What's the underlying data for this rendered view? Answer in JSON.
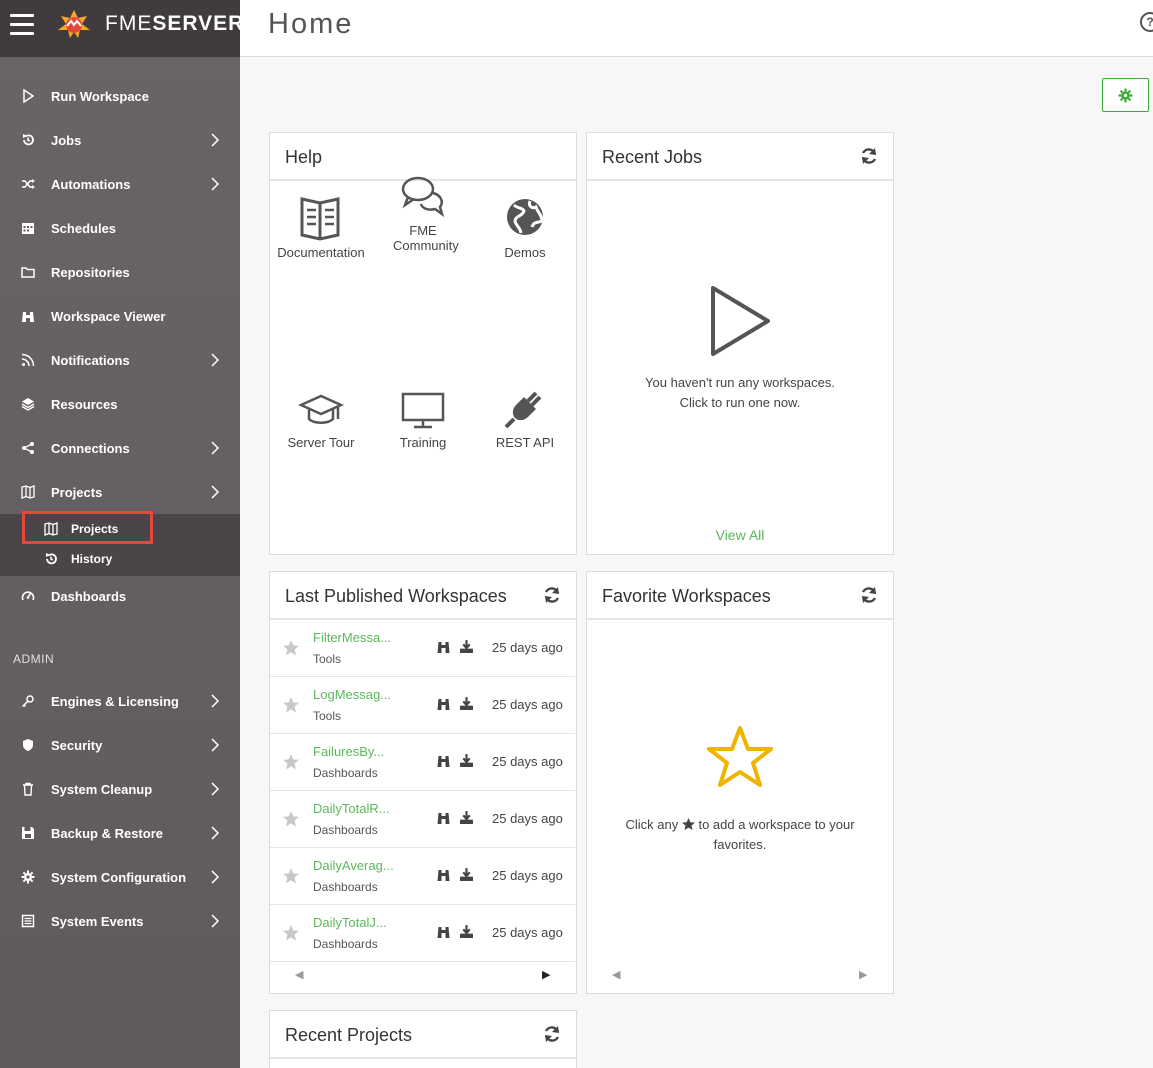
{
  "brand": {
    "logo_light": "FME",
    "logo_bold": "SERVER"
  },
  "header": {
    "title": "Home",
    "help_symbol": "?"
  },
  "nav": {
    "items": [
      {
        "label": "Run Workspace",
        "icon": "play-icon",
        "chevron": false
      },
      {
        "label": "Jobs",
        "icon": "history-icon",
        "chevron": true
      },
      {
        "label": "Automations",
        "icon": "shuffle-icon",
        "chevron": true
      },
      {
        "label": "Schedules",
        "icon": "calendar-icon",
        "chevron": false
      },
      {
        "label": "Repositories",
        "icon": "folder-icon",
        "chevron": false
      },
      {
        "label": "Workspace Viewer",
        "icon": "binoculars-icon",
        "chevron": false
      },
      {
        "label": "Notifications",
        "icon": "rss-icon",
        "chevron": true
      },
      {
        "label": "Resources",
        "icon": "layers-icon",
        "chevron": false
      },
      {
        "label": "Connections",
        "icon": "share-icon",
        "chevron": true
      },
      {
        "label": "Projects",
        "icon": "map-icon",
        "chevron": true
      }
    ],
    "sub_items": [
      {
        "label": "Projects",
        "icon": "map-icon"
      },
      {
        "label": "History",
        "icon": "history-icon"
      }
    ],
    "dashboards": {
      "label": "Dashboards",
      "icon": "dashboard-icon"
    },
    "admin_label": "ADMIN",
    "admin_items": [
      {
        "label": "Engines & Licensing",
        "icon": "key-icon"
      },
      {
        "label": "Security",
        "icon": "shield-icon"
      },
      {
        "label": "System Cleanup",
        "icon": "trash-icon"
      },
      {
        "label": "Backup & Restore",
        "icon": "save-icon"
      },
      {
        "label": "System Configuration",
        "icon": "gear-icon"
      },
      {
        "label": "System Events",
        "icon": "list-icon"
      }
    ]
  },
  "help_panel": {
    "title": "Help",
    "tiles": [
      {
        "label": "Documentation",
        "icon": "book-icon"
      },
      {
        "label": "FME Community",
        "icon": "chat-icon"
      },
      {
        "label": "Demos",
        "icon": "globe-icon"
      },
      {
        "label": "Server Tour",
        "icon": "graduation-cap-icon"
      },
      {
        "label": "Training",
        "icon": "monitor-icon"
      },
      {
        "label": "REST API",
        "icon": "plug-icon"
      }
    ]
  },
  "recent_jobs": {
    "title": "Recent Jobs",
    "empty_line1": "You haven't run any workspaces.",
    "empty_line2": "Click to run one now.",
    "view_all": "View All"
  },
  "last_published": {
    "title": "Last Published Workspaces",
    "rows": [
      {
        "name": "FilterMessa...",
        "category": "Tools",
        "age": "25 days ago"
      },
      {
        "name": "LogMessag...",
        "category": "Tools",
        "age": "25 days ago"
      },
      {
        "name": "FailuresBy...",
        "category": "Dashboards",
        "age": "25 days ago"
      },
      {
        "name": "DailyTotalR...",
        "category": "Dashboards",
        "age": "25 days ago"
      },
      {
        "name": "DailyAverag...",
        "category": "Dashboards",
        "age": "25 days ago"
      },
      {
        "name": "DailyTotalJ...",
        "category": "Dashboards",
        "age": "25 days ago"
      }
    ]
  },
  "favorites": {
    "title": "Favorite Workspaces",
    "text_before": "Click any",
    "text_after": "to add a workspace to your",
    "text_line2": "favorites."
  },
  "recent_projects": {
    "title": "Recent Projects"
  },
  "colors": {
    "accent": "#5cb85c",
    "sidebar": "#6a6468",
    "highlight": "#e2483b",
    "star": "#f0b400"
  }
}
